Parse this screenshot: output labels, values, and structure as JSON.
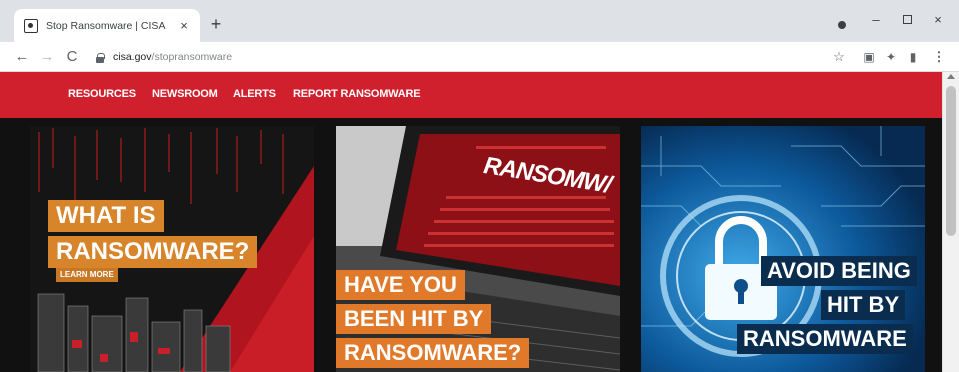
{
  "browser": {
    "tab_title": "Stop Ransomware | CISA",
    "tab_close": "×",
    "new_tab": "+",
    "url_host": "cisa.gov",
    "url_path": "/stopransomware",
    "window_min": "–",
    "window_close": "×",
    "icons": {
      "back": "←",
      "forward": "→",
      "reload": "C",
      "star": "☆",
      "ext1": "▣",
      "ext2": "✦",
      "ext3": "▮",
      "menu": "⋮"
    }
  },
  "site_nav": {
    "items": [
      "RESOURCES",
      "NEWSROOM",
      "ALERTS",
      "REPORT RANSOMWARE"
    ]
  },
  "cards": [
    {
      "lines": [
        "WHAT IS",
        "RANSOMWARE?"
      ],
      "cta": "LEARN MORE",
      "accent": "#d7842a"
    },
    {
      "screen_text": "RANSOMW/",
      "lines": [
        "HAVE YOU",
        "BEEN HIT BY",
        "RANSOMWARE?"
      ],
      "accent": "#e0792a"
    },
    {
      "lines": [
        "AVOID BEING",
        "HIT BY",
        "RANSOMWARE"
      ],
      "accent": "#0a2c4e"
    }
  ],
  "colors": {
    "brand_red": "#d0202e",
    "chrome_bg": "#dee1e6"
  }
}
